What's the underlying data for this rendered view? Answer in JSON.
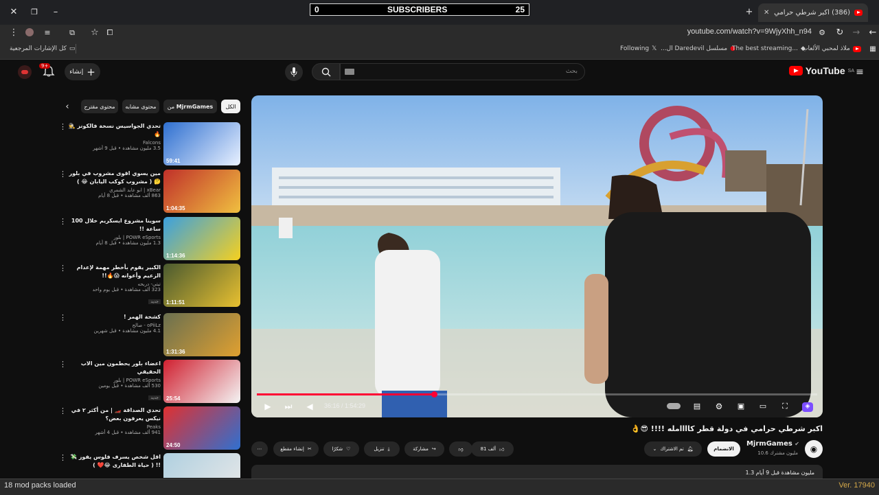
{
  "browser": {
    "tab_title": "(386) اكبر شرطي حرامي في دولة",
    "url": "youtube.com/watch?v=9WjyXhh_n94",
    "bookmarks": [
      "ملاذ لمحبي الألعاب",
      "The best streaming...",
      "مسلسل Daredevil ال...",
      "Following"
    ],
    "all_bookmarks": "كل الإشارات المرجعية"
  },
  "overlay": {
    "left": "0",
    "center": "SUBSCRIBERS",
    "right": "25"
  },
  "youtube": {
    "logo": "YouTube",
    "region": "SA",
    "search_placeholder": "بحث",
    "create_label": "إنشاء",
    "notif_count": "9+"
  },
  "chips": [
    "الكل",
    "من MjrmGames",
    "محتوى مشابه",
    "محتوى مقترح"
  ],
  "player": {
    "time": "36:16 / 1:54:29",
    "progress": 0.316
  },
  "video": {
    "title": "اكبر شرطي حرامي في دولة قطر كاااامله !!!! 😎👌",
    "channel": "MjrmGames",
    "subs": "10.6 مليون مشترك",
    "join": "الانضمام",
    "subscribed": "تم الاشتراك",
    "likes": "81 ألف",
    "share": "مشاركة",
    "download": "تنزيل",
    "thanks": "شكرًا",
    "clip": "إنشاء مقطع",
    "desc": "1.3 مليون مشاهدة  قبل 9 أيام"
  },
  "sidebar": [
    {
      "title": "تحدي الجواسيس نسخة فالكونز 🕵️🔥",
      "channel": "Falcons",
      "stats": "3.5 مليون مشاهدة • قبل 9 أشهر",
      "duration": "59:41",
      "badge": ""
    },
    {
      "title": "مين يسوي اقوى مشروب في بلور 🤔 ( مشروب كوكب اليابان 😂 )",
      "channel": "xBear | ابو عابد الشمري",
      "stats": "863 ألف مشاهدة • قبل 8 أيام",
      "duration": "1:04:35",
      "badge": ""
    },
    {
      "title": "سوينا مشروع ايسكريم خلال 100 ساعة !!",
      "channel": "POWR eSports | بلور",
      "stats": "1.3 مليون مشاهدة • قبل 8 أيام",
      "duration": "1:14:36",
      "badge": ""
    },
    {
      "title": "الكبير يقوم بأخطر مهمة لإعدام الزعيم وأعوانه 😱🔥!!",
      "channel": "تيتي- دربحه",
      "stats": "323 ألف مشاهدة • قبل يوم واحد",
      "duration": "1:11:51",
      "badge": "جديد"
    },
    {
      "title": "كشخة الهمر !",
      "channel": "oPiiLz - صالح",
      "stats": "4.1 مليون مشاهدة • قبل شهرين",
      "duration": "1:31:36",
      "badge": ""
    },
    {
      "title": "اعضاء بلور يحطمون مين الاب الحقيقي",
      "channel": "POWR eSports | بلور",
      "stats": "530 ألف مشاهدة • قبل يومين",
      "duration": "25:54",
      "badge": "جديد"
    },
    {
      "title": "تحدي الصداقة 🏎️ | من أكثر ٢ في نيكس يعرفون بعض؟",
      "channel": "Peaks",
      "stats": "941 ألف مشاهدة • قبل 4 أشهر",
      "duration": "24:50",
      "badge": ""
    },
    {
      "title": "اقل شخص يسرف فلوس يفوز 💸 !! ( حياة الطفارى 😂❤️ )",
      "channel": "",
      "stats": "",
      "duration": "",
      "badge": ""
    }
  ],
  "statusbar": {
    "mods": "18 mod packs loaded",
    "version": "Ver. 17940"
  }
}
